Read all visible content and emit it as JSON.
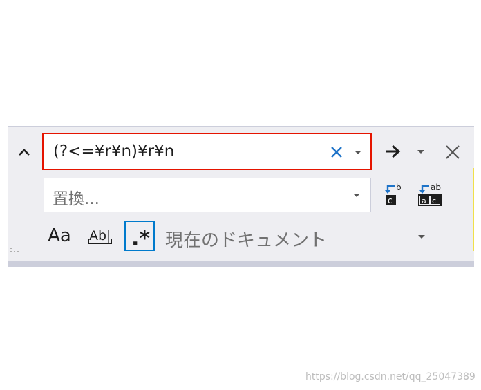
{
  "find": {
    "value": "(?<=¥r¥n)¥r¥n"
  },
  "replace": {
    "placeholder": "置換..."
  },
  "options": {
    "match_case_label": "Aa",
    "whole_word_label": "Ab|",
    "regex_label": ".*"
  },
  "scope": {
    "label": "現在のドキュメント"
  },
  "icons": [
    "chevron-up-icon",
    "clear-icon",
    "dropdown-icon",
    "arrow-right-icon",
    "close-icon",
    "replace-next-icon",
    "replace-all-icon",
    "grip-icon"
  ],
  "colors": {
    "panel_background": "#eeeef2",
    "find_border": "#e51400",
    "regex_active_border": "#007acc",
    "clear_icon": "#1e73c8"
  },
  "watermark": "https://blog.csdn.net/qq_25047389"
}
